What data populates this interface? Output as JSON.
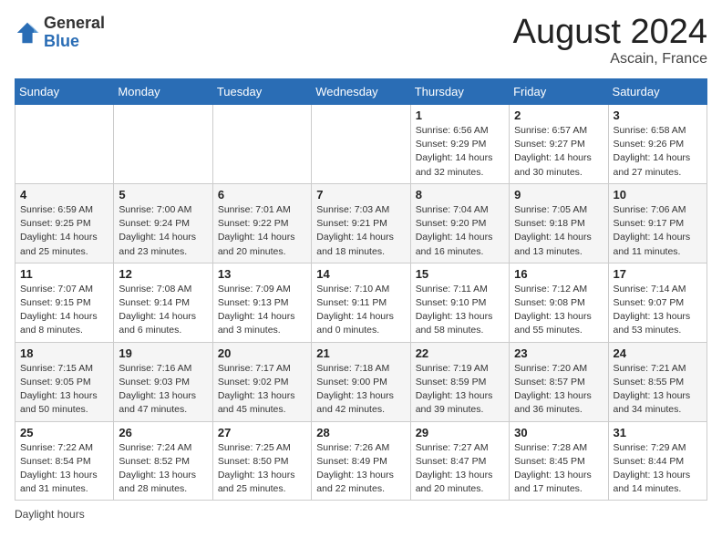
{
  "header": {
    "logo_general": "General",
    "logo_blue": "Blue",
    "month_year": "August 2024",
    "location": "Ascain, France"
  },
  "footer": {
    "daylight_label": "Daylight hours"
  },
  "weekdays": [
    "Sunday",
    "Monday",
    "Tuesday",
    "Wednesday",
    "Thursday",
    "Friday",
    "Saturday"
  ],
  "weeks": [
    [
      {
        "day": "",
        "sunrise": "",
        "sunset": "",
        "daylight": ""
      },
      {
        "day": "",
        "sunrise": "",
        "sunset": "",
        "daylight": ""
      },
      {
        "day": "",
        "sunrise": "",
        "sunset": "",
        "daylight": ""
      },
      {
        "day": "",
        "sunrise": "",
        "sunset": "",
        "daylight": ""
      },
      {
        "day": "1",
        "sunrise": "Sunrise: 6:56 AM",
        "sunset": "Sunset: 9:29 PM",
        "daylight": "Daylight: 14 hours and 32 minutes."
      },
      {
        "day": "2",
        "sunrise": "Sunrise: 6:57 AM",
        "sunset": "Sunset: 9:27 PM",
        "daylight": "Daylight: 14 hours and 30 minutes."
      },
      {
        "day": "3",
        "sunrise": "Sunrise: 6:58 AM",
        "sunset": "Sunset: 9:26 PM",
        "daylight": "Daylight: 14 hours and 27 minutes."
      }
    ],
    [
      {
        "day": "4",
        "sunrise": "Sunrise: 6:59 AM",
        "sunset": "Sunset: 9:25 PM",
        "daylight": "Daylight: 14 hours and 25 minutes."
      },
      {
        "day": "5",
        "sunrise": "Sunrise: 7:00 AM",
        "sunset": "Sunset: 9:24 PM",
        "daylight": "Daylight: 14 hours and 23 minutes."
      },
      {
        "day": "6",
        "sunrise": "Sunrise: 7:01 AM",
        "sunset": "Sunset: 9:22 PM",
        "daylight": "Daylight: 14 hours and 20 minutes."
      },
      {
        "day": "7",
        "sunrise": "Sunrise: 7:03 AM",
        "sunset": "Sunset: 9:21 PM",
        "daylight": "Daylight: 14 hours and 18 minutes."
      },
      {
        "day": "8",
        "sunrise": "Sunrise: 7:04 AM",
        "sunset": "Sunset: 9:20 PM",
        "daylight": "Daylight: 14 hours and 16 minutes."
      },
      {
        "day": "9",
        "sunrise": "Sunrise: 7:05 AM",
        "sunset": "Sunset: 9:18 PM",
        "daylight": "Daylight: 14 hours and 13 minutes."
      },
      {
        "day": "10",
        "sunrise": "Sunrise: 7:06 AM",
        "sunset": "Sunset: 9:17 PM",
        "daylight": "Daylight: 14 hours and 11 minutes."
      }
    ],
    [
      {
        "day": "11",
        "sunrise": "Sunrise: 7:07 AM",
        "sunset": "Sunset: 9:15 PM",
        "daylight": "Daylight: 14 hours and 8 minutes."
      },
      {
        "day": "12",
        "sunrise": "Sunrise: 7:08 AM",
        "sunset": "Sunset: 9:14 PM",
        "daylight": "Daylight: 14 hours and 6 minutes."
      },
      {
        "day": "13",
        "sunrise": "Sunrise: 7:09 AM",
        "sunset": "Sunset: 9:13 PM",
        "daylight": "Daylight: 14 hours and 3 minutes."
      },
      {
        "day": "14",
        "sunrise": "Sunrise: 7:10 AM",
        "sunset": "Sunset: 9:11 PM",
        "daylight": "Daylight: 14 hours and 0 minutes."
      },
      {
        "day": "15",
        "sunrise": "Sunrise: 7:11 AM",
        "sunset": "Sunset: 9:10 PM",
        "daylight": "Daylight: 13 hours and 58 minutes."
      },
      {
        "day": "16",
        "sunrise": "Sunrise: 7:12 AM",
        "sunset": "Sunset: 9:08 PM",
        "daylight": "Daylight: 13 hours and 55 minutes."
      },
      {
        "day": "17",
        "sunrise": "Sunrise: 7:14 AM",
        "sunset": "Sunset: 9:07 PM",
        "daylight": "Daylight: 13 hours and 53 minutes."
      }
    ],
    [
      {
        "day": "18",
        "sunrise": "Sunrise: 7:15 AM",
        "sunset": "Sunset: 9:05 PM",
        "daylight": "Daylight: 13 hours and 50 minutes."
      },
      {
        "day": "19",
        "sunrise": "Sunrise: 7:16 AM",
        "sunset": "Sunset: 9:03 PM",
        "daylight": "Daylight: 13 hours and 47 minutes."
      },
      {
        "day": "20",
        "sunrise": "Sunrise: 7:17 AM",
        "sunset": "Sunset: 9:02 PM",
        "daylight": "Daylight: 13 hours and 45 minutes."
      },
      {
        "day": "21",
        "sunrise": "Sunrise: 7:18 AM",
        "sunset": "Sunset: 9:00 PM",
        "daylight": "Daylight: 13 hours and 42 minutes."
      },
      {
        "day": "22",
        "sunrise": "Sunrise: 7:19 AM",
        "sunset": "Sunset: 8:59 PM",
        "daylight": "Daylight: 13 hours and 39 minutes."
      },
      {
        "day": "23",
        "sunrise": "Sunrise: 7:20 AM",
        "sunset": "Sunset: 8:57 PM",
        "daylight": "Daylight: 13 hours and 36 minutes."
      },
      {
        "day": "24",
        "sunrise": "Sunrise: 7:21 AM",
        "sunset": "Sunset: 8:55 PM",
        "daylight": "Daylight: 13 hours and 34 minutes."
      }
    ],
    [
      {
        "day": "25",
        "sunrise": "Sunrise: 7:22 AM",
        "sunset": "Sunset: 8:54 PM",
        "daylight": "Daylight: 13 hours and 31 minutes."
      },
      {
        "day": "26",
        "sunrise": "Sunrise: 7:24 AM",
        "sunset": "Sunset: 8:52 PM",
        "daylight": "Daylight: 13 hours and 28 minutes."
      },
      {
        "day": "27",
        "sunrise": "Sunrise: 7:25 AM",
        "sunset": "Sunset: 8:50 PM",
        "daylight": "Daylight: 13 hours and 25 minutes."
      },
      {
        "day": "28",
        "sunrise": "Sunrise: 7:26 AM",
        "sunset": "Sunset: 8:49 PM",
        "daylight": "Daylight: 13 hours and 22 minutes."
      },
      {
        "day": "29",
        "sunrise": "Sunrise: 7:27 AM",
        "sunset": "Sunset: 8:47 PM",
        "daylight": "Daylight: 13 hours and 20 minutes."
      },
      {
        "day": "30",
        "sunrise": "Sunrise: 7:28 AM",
        "sunset": "Sunset: 8:45 PM",
        "daylight": "Daylight: 13 hours and 17 minutes."
      },
      {
        "day": "31",
        "sunrise": "Sunrise: 7:29 AM",
        "sunset": "Sunset: 8:44 PM",
        "daylight": "Daylight: 13 hours and 14 minutes."
      }
    ]
  ]
}
